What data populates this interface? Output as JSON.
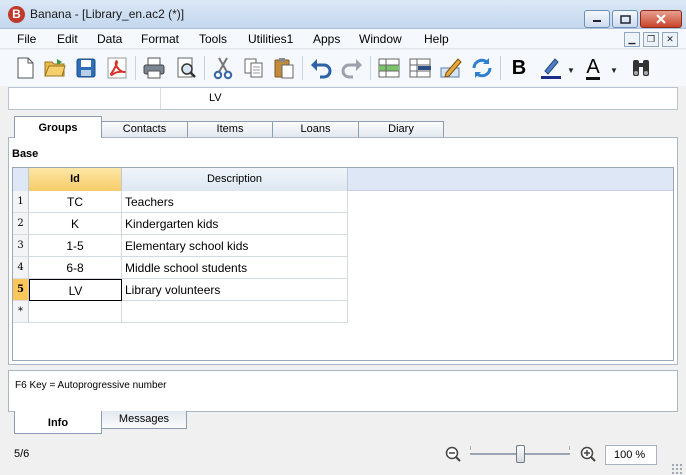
{
  "window": {
    "title": "Banana - [Library_en.ac2 (*)]",
    "controls": [
      "minimize",
      "maximize",
      "close"
    ]
  },
  "menu": [
    "File",
    "Edit",
    "Data",
    "Format",
    "Tools",
    "Utilities1",
    "Apps",
    "Window",
    "Help"
  ],
  "toolbar": [
    "new-file-icon",
    "open-folder-icon",
    "save-icon",
    "pdf-icon",
    "print-icon",
    "print-preview-icon",
    "cut-icon",
    "copy-icon",
    "paste-icon",
    "undo-icon",
    "redo-icon",
    "insert-row-icon",
    "delete-row-icon",
    "edit-cell-icon",
    "recalculate-icon",
    "bold-icon",
    "highlight-icon",
    "font-color-icon",
    "find-icon"
  ],
  "toolbar_labels": {
    "bold": "B",
    "font_color": "A"
  },
  "cellbar": {
    "address": "",
    "value": "LV"
  },
  "tabs": [
    {
      "label": "Groups",
      "active": true
    },
    {
      "label": "Contacts"
    },
    {
      "label": "Items"
    },
    {
      "label": "Loans"
    },
    {
      "label": "Diary"
    }
  ],
  "view": {
    "label": "Base"
  },
  "table": {
    "columns": [
      "Id",
      "Description"
    ],
    "rows": [
      {
        "num": "1",
        "id": "TC",
        "description": "Teachers"
      },
      {
        "num": "2",
        "id": "K",
        "description": "Kindergarten kids"
      },
      {
        "num": "3",
        "id": "1-5",
        "description": "Elementary school kids"
      },
      {
        "num": "4",
        "id": "6-8",
        "description": "Middle school students"
      },
      {
        "num": "5",
        "id": "LV",
        "description": "Library volunteers"
      },
      {
        "num": "*",
        "id": "",
        "description": ""
      }
    ],
    "current_row": "5"
  },
  "info": {
    "text": "F6 Key = Autoprogressive number"
  },
  "bottom_tabs": [
    {
      "label": "Info",
      "active": true
    },
    {
      "label": "Messages"
    }
  ],
  "status": {
    "position": "5/6",
    "zoom": "100 %"
  },
  "colors": {
    "header_accent": "#f8cc68",
    "current_row": "#f9c75c",
    "pdf_red": "#d8322b",
    "close_red": "#c8442c"
  }
}
